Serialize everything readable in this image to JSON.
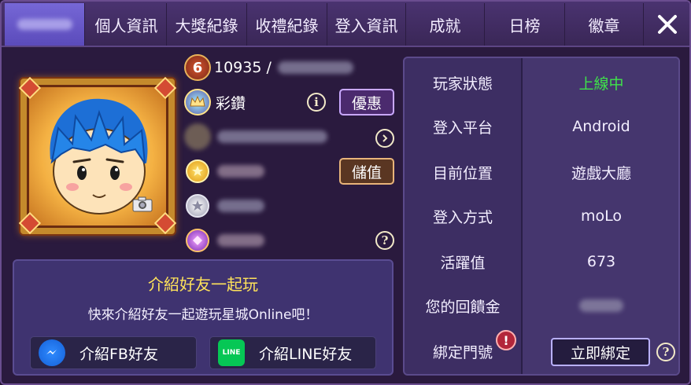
{
  "tabs": [
    {
      "label": "",
      "active": true
    },
    {
      "label": "個人資訊"
    },
    {
      "label": "大獎紀錄"
    },
    {
      "label": "收禮紀錄"
    },
    {
      "label": "登入資訊"
    },
    {
      "label": "成就"
    },
    {
      "label": "日榜"
    },
    {
      "label": "徽章"
    }
  ],
  "profile": {
    "level": "6",
    "id_text": "10935 /",
    "vip_label": "彩鑽",
    "promo_button": "優惠",
    "topup_button": "儲值"
  },
  "invite": {
    "title": "介紹好友一起玩",
    "subtitle": "快來介紹好友一起遊玩星城Online吧！",
    "fb_button": "介紹FB好友",
    "line_button": "介紹LINE好友"
  },
  "status": {
    "rows": [
      {
        "key": "玩家狀態",
        "value": "上線中"
      },
      {
        "key": "登入平台",
        "value": "Android"
      },
      {
        "key": "目前位置",
        "value": "遊戲大廳"
      },
      {
        "key": "登入方式",
        "value": "moLo"
      },
      {
        "key": "活躍值",
        "value": "673"
      },
      {
        "key": "您的回饋金",
        "value": ""
      },
      {
        "key": "綁定門號",
        "value": ""
      }
    ],
    "bind_button": "立即綁定"
  },
  "colors": {
    "online": "#3fe34a",
    "invite_title": "#ffe35a",
    "tab_active": "#6b5ccb"
  }
}
